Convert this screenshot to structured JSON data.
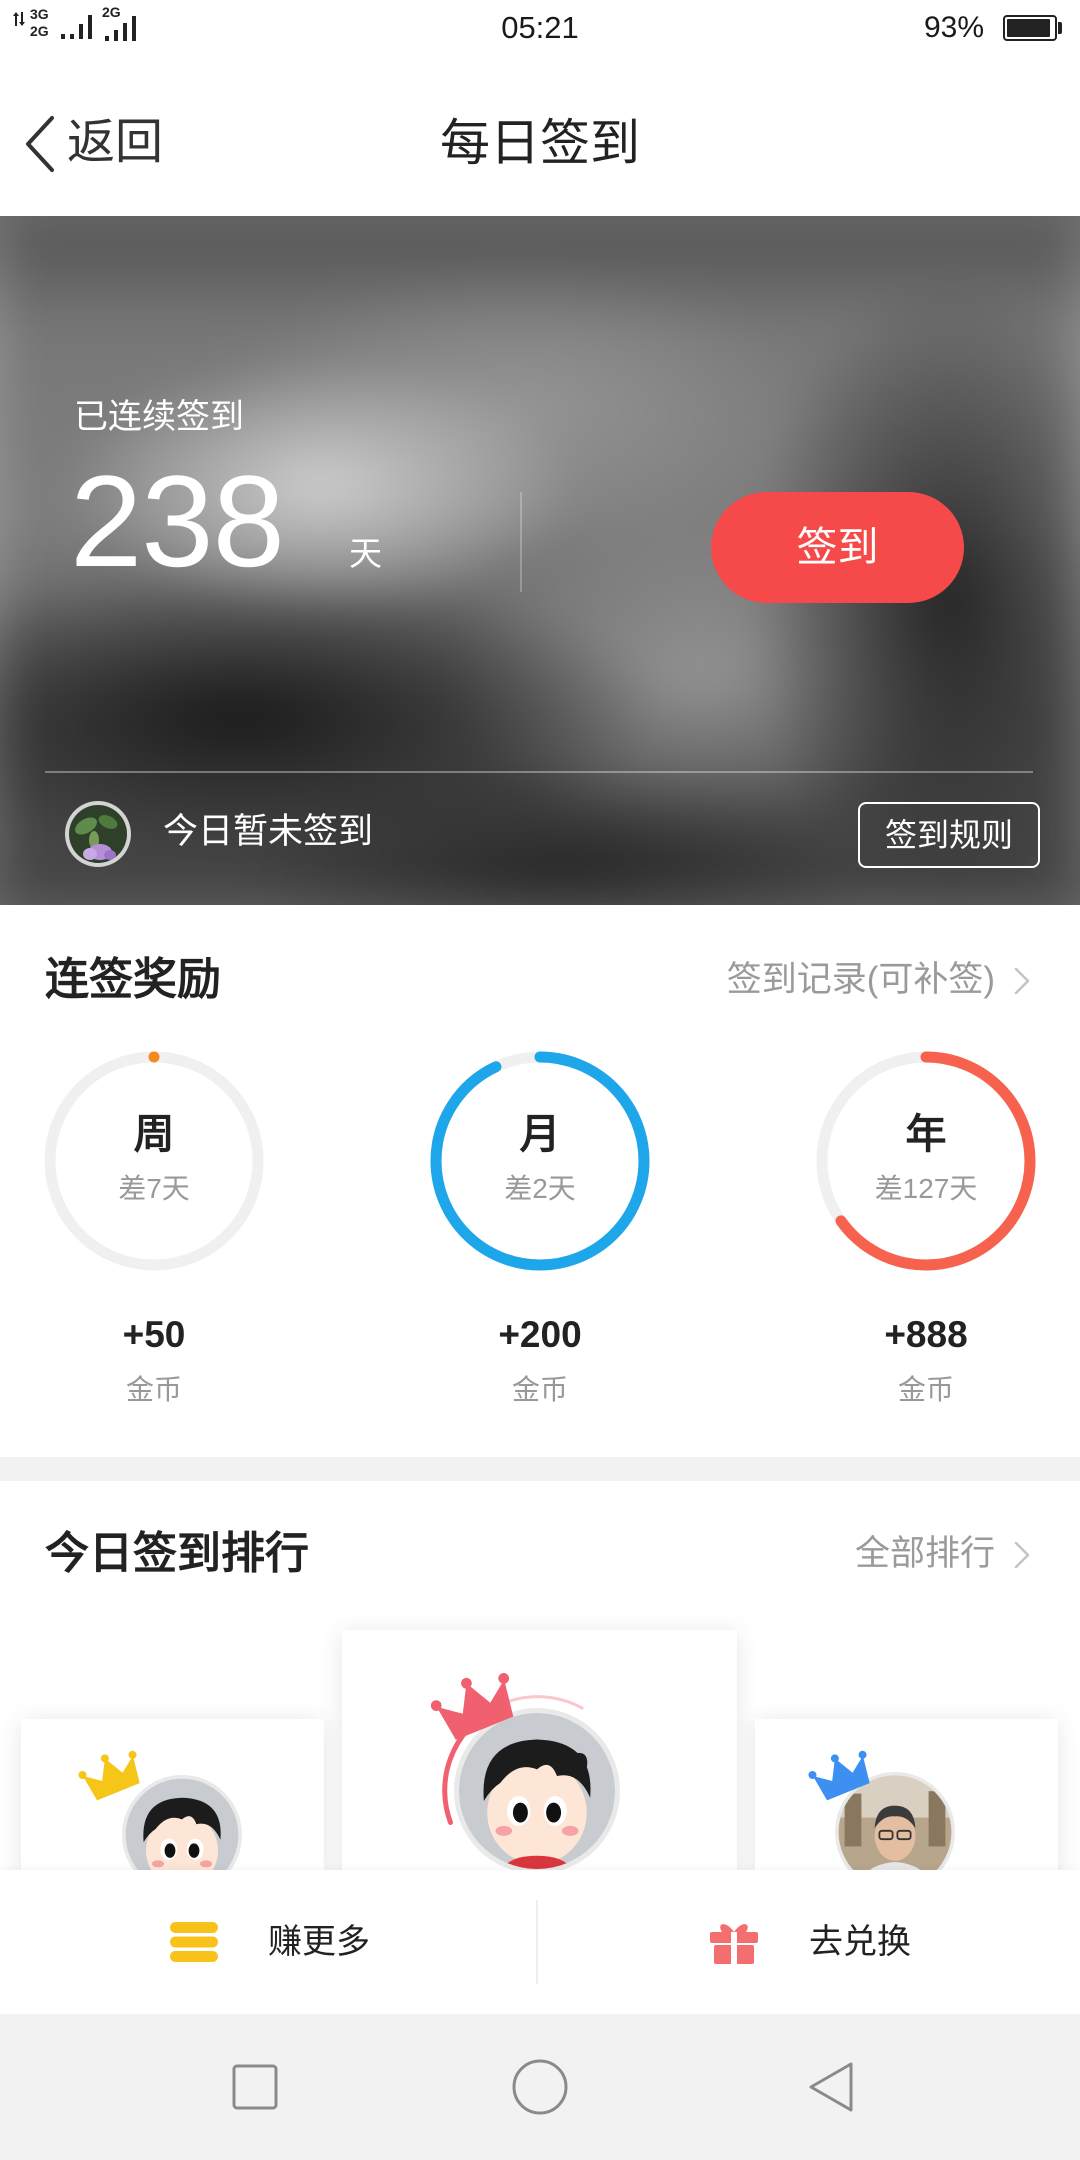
{
  "status_bar": {
    "sim1_top": "3G",
    "sim1_bottom": "2G",
    "sim2": "2G",
    "time": "05:21",
    "battery": "93%",
    "battery_level": 0.93
  },
  "header": {
    "back_label": "返回",
    "title": "每日签到"
  },
  "hero": {
    "streak_label": "已连续签到",
    "streak_days": "238",
    "streak_unit": "天",
    "checkin_button": "签到",
    "today_status": "今日暂未签到",
    "rules_button": "签到规则"
  },
  "rewards": {
    "title": "连签奖励",
    "record_link": "签到记录(可补签)",
    "items": [
      {
        "period": "周",
        "remaining": "差7天",
        "progress": 0.0,
        "color": "#f5891f",
        "reward": "+50",
        "unit": "金币"
      },
      {
        "period": "月",
        "remaining": "差2天",
        "progress": 0.93,
        "color": "#1ea6ea",
        "reward": "+200",
        "unit": "金币"
      },
      {
        "period": "年",
        "remaining": "差127天",
        "progress": 0.652,
        "color": "#f6624d",
        "reward": "+888",
        "unit": "金币"
      }
    ]
  },
  "ranking": {
    "title": "今日签到排行",
    "all_link": "全部排行",
    "podium": [
      {
        "crown_color": "#f5c518",
        "avatar_icon": "cartoon-boy-avatar"
      },
      {
        "crown_color": "#f0606e",
        "avatar_icon": "cartoon-boy-avatar"
      },
      {
        "crown_color": "#3d8ff2",
        "avatar_icon": "photo-avatar"
      }
    ]
  },
  "actions": {
    "earn_more": "赚更多",
    "earn_more_icon": "coin-stack-icon",
    "exchange": "去兑换",
    "exchange_icon": "gift-icon"
  },
  "nav": {
    "icons": [
      "recent-apps-icon",
      "home-icon",
      "back-triangle-icon"
    ]
  },
  "colors": {
    "checkin_button": "#f64a4a",
    "coin_icon": "#f8c21a",
    "gift_icon": "#f36f6f"
  }
}
